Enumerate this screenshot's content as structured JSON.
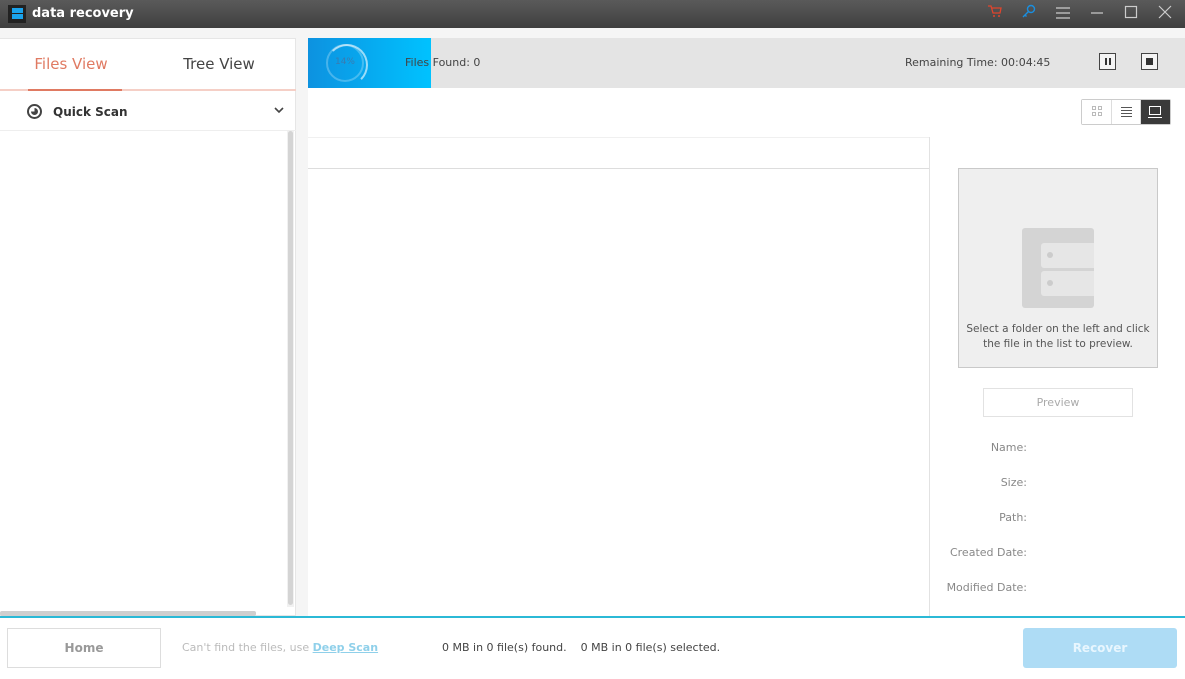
{
  "titlebar": {
    "title": "data recovery",
    "icons": [
      "cart-icon",
      "key-icon",
      "menu-icon",
      "minimize-icon",
      "maximize-icon",
      "close-icon"
    ],
    "cart_color": "#e0452d",
    "key_color": "#1a8fe0"
  },
  "sidebar": {
    "tabs": [
      {
        "label": "Files View",
        "active": true
      },
      {
        "label": "Tree View",
        "active": false
      }
    ],
    "scan_item": {
      "label": "Quick Scan",
      "icon": "scan-progress-icon"
    }
  },
  "progress": {
    "percent_label": "14%",
    "fraction": 0.14,
    "files_found": "Files Found:  0",
    "remaining": "Remaining Time: 00:04:45"
  },
  "view_modes": [
    "thumbnail-view",
    "list-view",
    "preview-view"
  ],
  "active_view": "preview-view",
  "preview": {
    "hint": "Select a folder on the left and click the file in the list to preview.",
    "button_label": "Preview",
    "properties": [
      "Name:",
      "Size:",
      "Path:",
      "Created Date:",
      "Modified Date:"
    ]
  },
  "footer": {
    "home_label": "Home",
    "cant_find": "Can't find the files, use ",
    "deep_scan": "Deep Scan",
    "stats": "0 MB in 0 file(s) found.    0 MB in 0 file(s) selected.",
    "recover_label": "Recover"
  },
  "colors": {
    "accent_tab": "#e07a62",
    "progress": "#0d92e0",
    "bottom_line": "#2bb9d6",
    "recover_disabled": "#aedcf5"
  }
}
